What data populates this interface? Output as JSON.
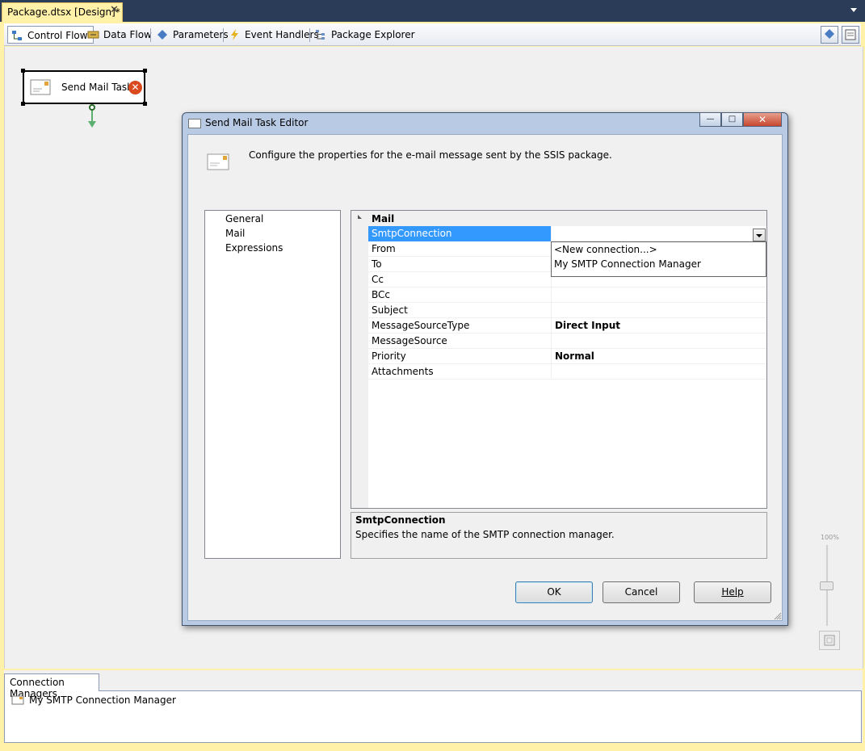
{
  "doc_tab": {
    "title": "Package.dtsx [Design]*",
    "close": "✕"
  },
  "designer_tabs": [
    {
      "label": "Control Flow",
      "icon": "control-flow-icon"
    },
    {
      "label": "Data Flow",
      "icon": "data-flow-icon"
    },
    {
      "label": "Parameters",
      "icon": "parameters-icon"
    },
    {
      "label": "Event Handlers",
      "icon": "event-handlers-icon"
    },
    {
      "label": "Package Explorer",
      "icon": "package-explorer-icon"
    }
  ],
  "canvas": {
    "task": {
      "label": "Send Mail Task",
      "error_glyph": "✕"
    },
    "zoom_label": "100%"
  },
  "connection_managers": {
    "tab_label": "Connection Managers",
    "items": [
      "My SMTP Connection Manager"
    ]
  },
  "dialog": {
    "title": "Send Mail Task Editor",
    "window_buttons": {
      "minimize": "—",
      "maximize": "□",
      "close": "✕"
    },
    "header_text": "Configure the properties for the e-mail message sent by the SSIS package.",
    "nav_items": [
      "General",
      "Mail",
      "Expressions"
    ],
    "selected_nav": "Mail",
    "category": "Mail",
    "properties": [
      {
        "name": "SmtpConnection",
        "value": "",
        "selected": true
      },
      {
        "name": "From",
        "value": ""
      },
      {
        "name": "To",
        "value": ""
      },
      {
        "name": "Cc",
        "value": ""
      },
      {
        "name": "BCc",
        "value": ""
      },
      {
        "name": "Subject",
        "value": ""
      },
      {
        "name": "MessageSourceType",
        "value": "Direct Input"
      },
      {
        "name": "MessageSource",
        "value": ""
      },
      {
        "name": "Priority",
        "value": "Normal"
      },
      {
        "name": "Attachments",
        "value": ""
      }
    ],
    "dropdown_options": [
      "<New connection...>",
      "My SMTP Connection Manager"
    ],
    "description": {
      "title": "SmtpConnection",
      "text": "Specifies the name of the SMTP connection manager."
    },
    "buttons": {
      "ok": "OK",
      "cancel": "Cancel",
      "help": "Help"
    }
  }
}
